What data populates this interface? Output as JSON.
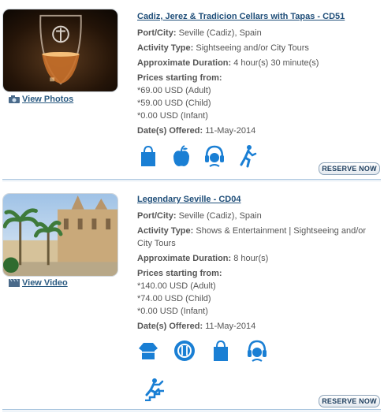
{
  "tours": [
    {
      "title": "Cadiz, Jerez & Tradicion Cellars with Tapas - CD51",
      "media_link": "View Photos",
      "port_label": "Port/City:",
      "port_value": "Seville (Cadiz), Spain",
      "activity_label": "Activity Type:",
      "activity_value": "Sightseeing and/or City Tours",
      "duration_label": "Approximate Duration:",
      "duration_value": "4 hour(s) 30 minute(s)",
      "prices_heading": "Prices starting from:",
      "price_adult": "*69.00 USD (Adult)",
      "price_child": "*59.00 USD (Child)",
      "price_infant": "*0.00 USD (Infant)",
      "dates_label": "Date(s) Offered:",
      "dates_value": "11-May-2014",
      "amenities": [
        "shopping-bag-icon",
        "apple-food-icon",
        "audio-guide-icon",
        "walking-icon"
      ],
      "reserve_label": "RESERVE NOW"
    },
    {
      "title": "Legendary Seville - CD04",
      "media_link": "View Video",
      "port_label": "Port/City:",
      "port_value": "Seville (Cadiz), Spain",
      "activity_label": "Activity Type:",
      "activity_value": "Shows & Entertainment | Sightseeing and/or City Tours",
      "duration_label": "Approximate Duration:",
      "duration_value": "8 hour(s)",
      "prices_heading": "Prices starting from:",
      "price_adult": "*140.00 USD (Adult)",
      "price_child": "*74.00 USD (Child)",
      "price_infant": "*0.00 USD (Infant)",
      "dates_label": "Date(s) Offered:",
      "dates_value": "11-May-2014",
      "amenities": [
        "dress-code-icon",
        "meal-plate-icon",
        "shopping-bag-icon",
        "audio-guide-icon",
        "stairs-climbing-icon"
      ],
      "reserve_label": "RESERVE NOW"
    }
  ],
  "colors": {
    "link": "#1f4e79",
    "icon_blue": "#1a7fd4",
    "text": "#555555",
    "divider": "#a8c4de"
  }
}
